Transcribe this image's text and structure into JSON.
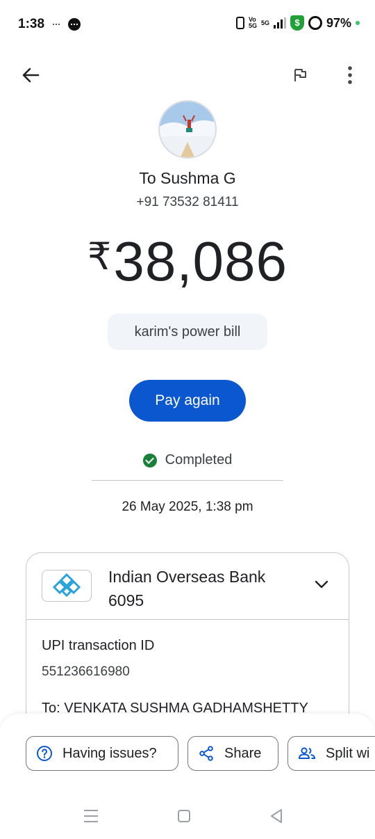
{
  "status_bar": {
    "time": "1:38",
    "network_volte": "Vo\n5G",
    "network_5g": "5G",
    "battery": "97%"
  },
  "top_bar": {
    "back_icon": "arrow-left-icon",
    "flag_icon": "flag-icon",
    "more_icon": "more-vert-icon"
  },
  "payee": {
    "name": "To Sushma G",
    "phone": "+91 73532 81411"
  },
  "payment": {
    "currency": "₹",
    "amount": "38,086",
    "note": "karim's power bill",
    "pay_again_label": "Pay again",
    "status": "Completed",
    "datetime": "26 May 2025, 1:38 pm"
  },
  "bank_card": {
    "bank_name": "Indian Overseas Bank",
    "account_suffix": "6095",
    "upi_label": "UPI transaction ID",
    "upi_id": "551236616980",
    "to_label": "To: VENKATA SUSHMA GADHAMSHETTY"
  },
  "actions": {
    "issues_label": "Having issues?",
    "share_label": "Share",
    "split_label": "Split wi"
  },
  "colors": {
    "primary": "#0b57d0",
    "success": "#188038",
    "chip_bg": "#f1f4f9",
    "bank_logo": "#2aa3dc"
  }
}
